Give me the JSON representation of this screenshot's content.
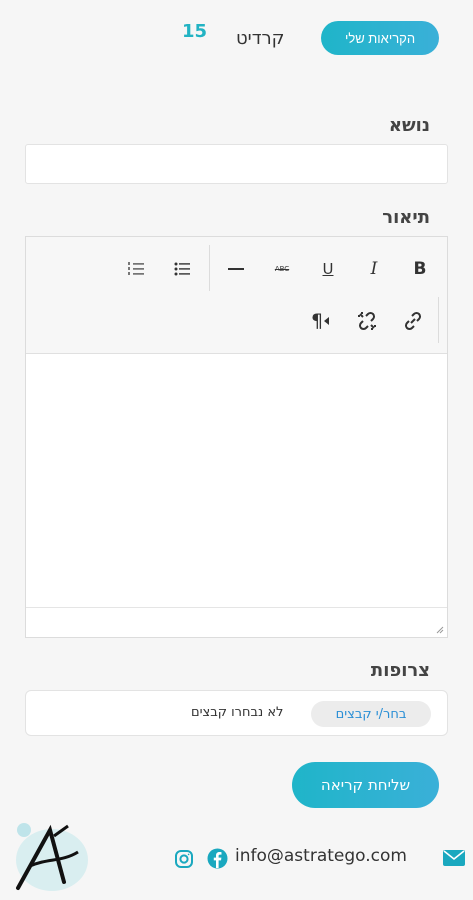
{
  "header": {
    "my_calls_label": "הקריאות שלי",
    "credit_label": "קרדיט",
    "credit_count": "15"
  },
  "form": {
    "subject_label": "נושא",
    "subject_value": "",
    "description_label": "תיאור",
    "attachments_label": "צרופות",
    "choose_files_label": "בחר/י קבצים",
    "no_files_text": "לא נבחרו קבצים",
    "submit_label": "שליחת קריאה"
  },
  "editor": {
    "toolbar_row1": [
      "bold-icon",
      "italic-icon",
      "underline-icon",
      "strikethrough-icon",
      "horizontal-line-icon",
      "bullet-list-icon",
      "numbered-list-icon"
    ],
    "toolbar_row2": [
      "link-icon",
      "unlink-icon",
      "paragraph-direction-icon"
    ],
    "bold_glyph": "B",
    "italic_glyph": "I",
    "underline_glyph": "U",
    "strike_glyph": "ABC",
    "paragraph_glyph": "¶"
  },
  "footer": {
    "email": "info@astratego.com",
    "icons": [
      "envelope-icon",
      "facebook-icon",
      "instagram-icon",
      "logo"
    ]
  },
  "colors": {
    "accent": "#22b3c3",
    "link": "#2a8fd6",
    "background": "#f6f6f6"
  }
}
